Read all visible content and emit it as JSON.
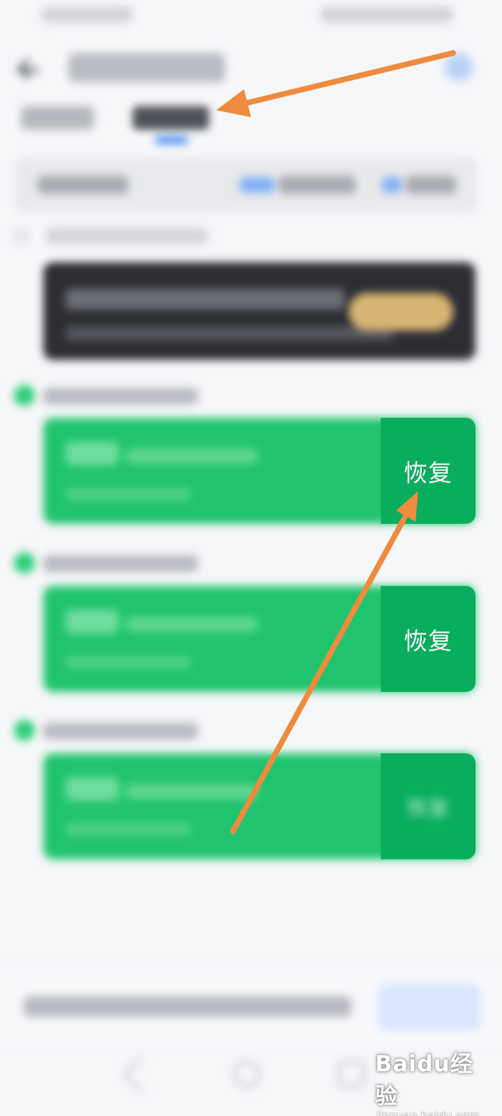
{
  "cards": [
    {
      "restore_label": "恢复",
      "restore_visible": true
    },
    {
      "restore_label": "恢复",
      "restore_visible": true
    },
    {
      "restore_label": "恢复",
      "restore_visible": false
    }
  ],
  "watermark": {
    "main": "Baidu经验",
    "sub": "jingyan.baidu.com"
  },
  "colors": {
    "accent_green": "#21c46e",
    "restore_green": "#09ad5e",
    "arrow_orange": "#f08a3c",
    "tab_blue": "#3f86f5"
  }
}
